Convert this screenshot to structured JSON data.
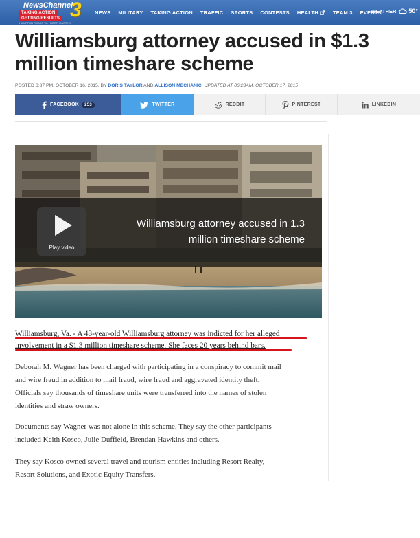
{
  "header": {
    "logo": {
      "name": "NewsChannel",
      "number": "3",
      "tag1": "TAKING ACTION",
      "tag2": "GETTING RESULTS",
      "region": "HAMPTON ROADS VA · NORTHEAST NC"
    },
    "nav": [
      "NEWS",
      "MILITARY",
      "TAKING ACTION",
      "TRAFFIC",
      "SPORTS",
      "CONTESTS",
      "HEALTH",
      "TEAM 3",
      "EVENTS"
    ],
    "weather_label": "WEATHER",
    "weather_temp": "50°",
    "colors": {
      "nav_bg": "#2d5ea6",
      "logo_accent": "#d9232e",
      "logo_number": "#f7d21e"
    }
  },
  "article": {
    "headline": "Williamsburg attorney accused in $1.3 million timeshare scheme",
    "byline": {
      "prefix": "POSTED 6:37 PM, OCTOBER 16, 2015, BY",
      "author1": "DORIS TAYLOR",
      "and": "AND",
      "author2": "ALLISON MECHANIC",
      "updated": ", UPDATED AT 06:23AM, OCTOBER 17, 2015"
    },
    "share": {
      "facebook": "FACEBOOK",
      "facebook_count": "253",
      "twitter": "TWITTER",
      "reddit": "REDDIT",
      "pinterest": "PINTEREST",
      "linkedin": "LINKEDIN"
    },
    "video": {
      "title_line1": "Williamsburg attorney accused in 1.3",
      "title_line2": "million timeshare scheme",
      "play_label": "Play video"
    },
    "lede": [
      "Williamsburg, Va. - A 43-year-old Williamsburg attorney was indicted for her alleged",
      "involvement in a $1.3 million timeshare scheme. She faces 20 years behind bars."
    ],
    "paragraphs": [
      [
        "Deborah M. Wagner has been charged with participating in a conspiracy to commit mail",
        "and wire fraud in addition to mail fraud, wire fraud and aggravated identity theft.",
        "Officials say thousands of timeshare units were transferred into the names of stolen",
        "identities and straw owners."
      ],
      [
        "Documents say Wagner was not alone in this scheme. They say the other participants",
        "included Keith Kosco, Julie Duffield, Brendan Hawkins and others."
      ],
      [
        "They say Kosco owned several travel and tourism entities including Resort Realty,",
        "Resort Solutions, and Exotic Equity Transfers."
      ]
    ],
    "colors": {
      "link": "#2b6fc5",
      "facebook": "#3b5b99",
      "twitter": "#4aa3e8",
      "highlight": "#d4141e"
    }
  }
}
